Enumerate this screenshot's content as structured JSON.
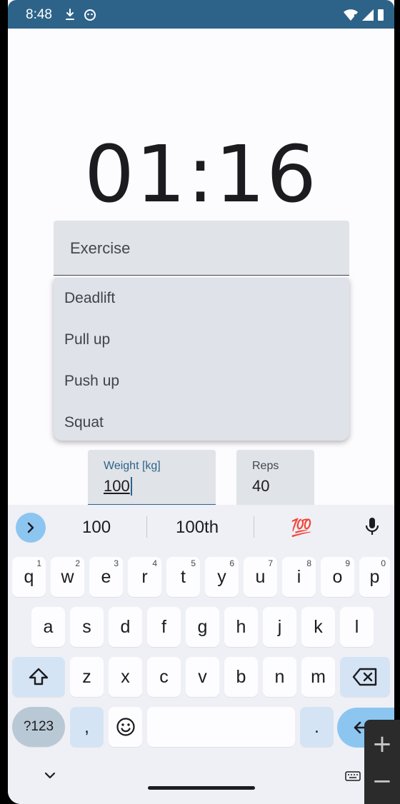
{
  "status_bar": {
    "time": "8:48"
  },
  "timer": {
    "value": "01:16"
  },
  "exercise_field": {
    "label": "Exercise"
  },
  "exercise_options": [
    "Deadlift",
    "Pull up",
    "Push up",
    "Squat"
  ],
  "weight_field": {
    "label": "Weight [kg]",
    "value": "100"
  },
  "reps_field": {
    "label": "Reps",
    "value": "40"
  },
  "keyboard": {
    "suggestions": [
      "100",
      "100th",
      "💯"
    ],
    "row1": [
      {
        "key": "q",
        "hint": "1"
      },
      {
        "key": "w",
        "hint": "2"
      },
      {
        "key": "e",
        "hint": "3"
      },
      {
        "key": "r",
        "hint": "4"
      },
      {
        "key": "t",
        "hint": "5"
      },
      {
        "key": "y",
        "hint": "6"
      },
      {
        "key": "u",
        "hint": "7"
      },
      {
        "key": "i",
        "hint": "8"
      },
      {
        "key": "o",
        "hint": "9"
      },
      {
        "key": "p",
        "hint": "0"
      }
    ],
    "row2": [
      "a",
      "s",
      "d",
      "f",
      "g",
      "h",
      "j",
      "k",
      "l"
    ],
    "row3": [
      "z",
      "x",
      "c",
      "v",
      "b",
      "n",
      "m"
    ],
    "symbols_label": "?123",
    "comma_label": ",",
    "period_label": ".",
    "accent_color": "#8cc6f0"
  },
  "zoom": {
    "in_label": "+",
    "out_label": "−"
  },
  "colors": {
    "primary": "#2d6389",
    "field_bg": "#e0e3e8"
  }
}
